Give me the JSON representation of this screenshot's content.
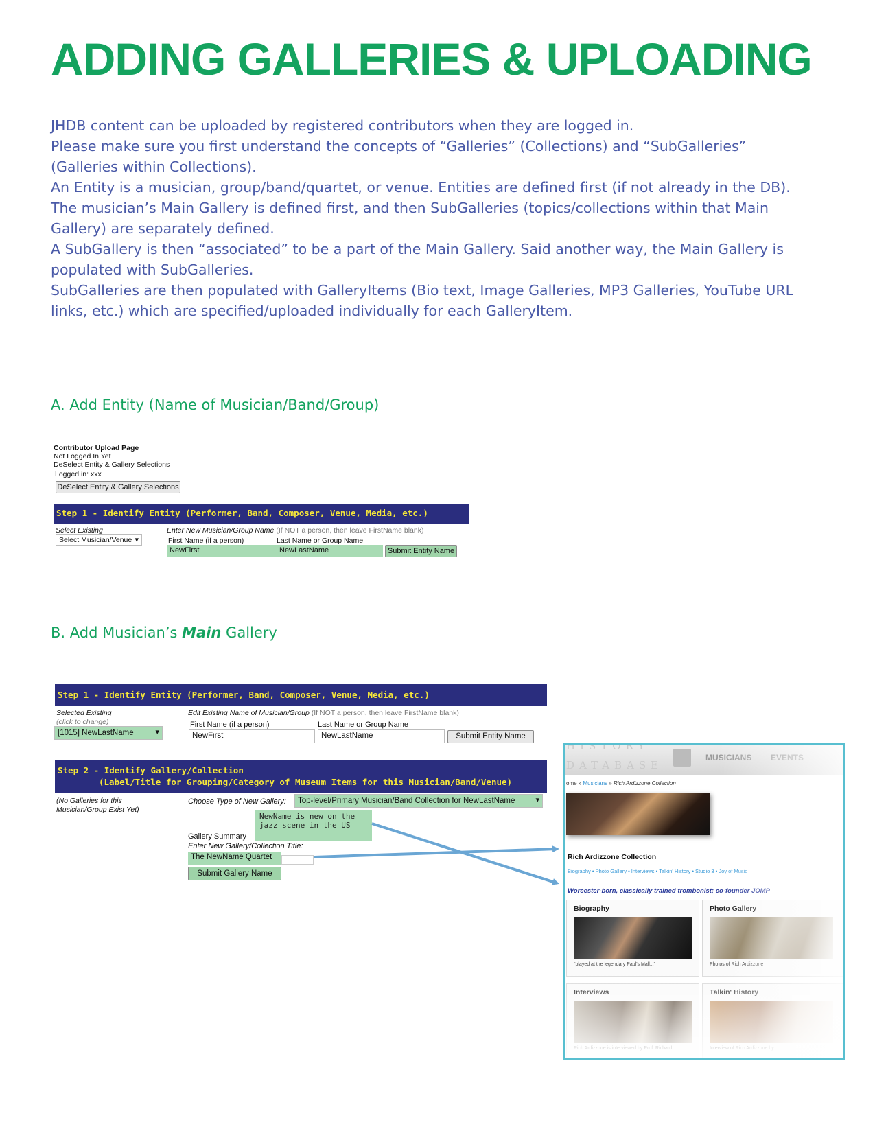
{
  "title": "ADDING GALLERIES & UPLOADING",
  "intro": [
    "JHDB content can be uploaded by registered contributors when they are logged in.",
    "Please make sure you first understand the concepts of “Galleries” (Collections) and “SubGalleries” (Galleries within Collections).",
    "An Entity is a musician, group/band/quartet, or venue.  Entities are defined first (if not already in the DB).",
    "The musician’s Main Gallery is defined first, and then SubGalleries (topics/collections  within that Main Gallery)  are separately defined.",
    "A SubGallery is then “associated” to be a part of the Main Gallery.  Said another way, the Main Gallery is populated with SubGalleries.",
    "SubGalleries are then populated with GalleryItems (Bio text, Image Galleries, MP3 Galleries, YouTube URL links, etc.) which are specified/uploaded individually for each GalleryItem."
  ],
  "sectionA": {
    "heading": "A. Add Entity (Name of Musician/Band/Group)",
    "page_title": "Contributor Upload Page",
    "not_logged": "Not Logged In Yet",
    "deselect_text": "DeSelect Entity & Gallery Selections",
    "logged_in": "Logged in: xxx",
    "deselect_button": "DeSelect Entity & Gallery Selections",
    "step1": "Step 1 - Identify Entity (Performer, Band, Composer, Venue, Media, etc.)",
    "select_existing": "Select Existing",
    "select_value": "Select Musician/Venue",
    "enter_new": "Enter New Musician/Group Name",
    "enter_new_note": "(If NOT a person, then leave FirstName blank)",
    "first_label": "First Name (if a person)",
    "last_label": "Last Name or Group Name",
    "first_value": "NewFirst",
    "last_value": "NewLastName",
    "submit": "Submit Entity Name"
  },
  "sectionB": {
    "heading_pre": "B. Add Musician’s ",
    "heading_em": "Main",
    "heading_post": " Gallery",
    "step1": "Step 1 - Identify Entity (Performer, Band, Composer, Venue, Media, etc.)",
    "selected_existing": "Selected Existing",
    "click_change": "(click to change)",
    "selected_value": "[1015] NewLastName",
    "edit_existing": "Edit Existing Name of Musician/Group",
    "edit_note": "(If NOT a person, then leave FirstName blank)",
    "first_label": "First Name (if a person)",
    "last_label": "Last Name or Group Name",
    "first_value": "NewFirst",
    "last_value": "NewLastName",
    "submit_entity": "Submit Entity Name",
    "step2_line1": "Step 2 - Identify Gallery/Collection",
    "step2_line2": "(Label/Title for Grouping/Category of Museum Items for this Musician/Band/Venue)",
    "no_galleries_1": "(No Galleries for this",
    "no_galleries_2": "Musician/Group Exist Yet)",
    "choose_type": "Choose Type of New Gallery:",
    "type_value": "Top-level/Primary Musician/Band Collection for NewLastName",
    "summary_1": "NewName is new on the",
    "summary_2": "jazz scene in the US",
    "summary_label": "Gallery Summary",
    "enter_title": "Enter New Gallery/Collection Title:",
    "title_value": "The NewName Quartet",
    "submit_gallery": "Submit Gallery Name"
  },
  "site": {
    "logo_1": "HISTORY",
    "logo_2": "DATABASE",
    "menu_1": "MUSICIANS",
    "menu_2": "EVENTS",
    "crumb_home": "ome » ",
    "crumb_musicians": "Musicians",
    "crumb_sep": " » ",
    "crumb_current": "Rich Ardizzone Collection",
    "collection_title": "Rich Ardizzone Collection",
    "links": "Biography  •  Photo Gallery  •  Interviews  •  Talkin' History  •  Studio 3  •  Joy of Music",
    "tagline": "Worcester-born, classically trained trombonist; co-founder JOMP",
    "box1_title": "Biography",
    "box1_caption": "\"played at the legendary Paul's Mall...\"",
    "box2_title": "Photo Gallery",
    "box2_caption": "Photos of Rich Ardizzone",
    "box3_title": "Interviews",
    "box3_caption": "Rich Ardizzone is interviewed by Prof. Richard",
    "box4_title": "Talkin' History",
    "box4_caption": "Interview of Rich Ardizzone by",
    "arrow_color": "#6aa6d4",
    "accent_green": "#14a35f",
    "bar_navy": "#2a2d7e"
  }
}
